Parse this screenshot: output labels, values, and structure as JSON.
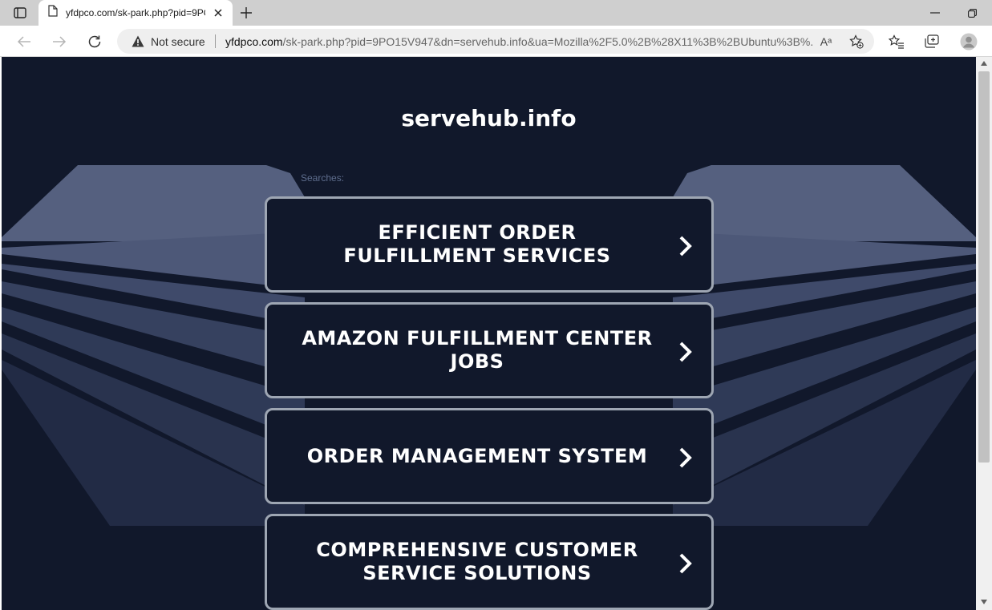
{
  "browser": {
    "tab_title": "yfdpco.com/sk-park.php?pid=9PO15V947",
    "security_label": "Not secure",
    "url_host": "yfdpco.com",
    "url_rest": "/sk-park.php?pid=9PO15V947&dn=servehub.info&ua=Mozilla%2F5.0%2B%28X11%3B%2BUbuntu%3B%...",
    "read_aloud_glyph": "Aᵃ"
  },
  "page": {
    "site_title": "servehub.info",
    "searches_label": "Searches:",
    "links": [
      {
        "label": "EFFICIENT ORDER FULFILLMENT SERVICES"
      },
      {
        "label": "AMAZON FULFILLMENT CENTER JOBS"
      },
      {
        "label": "ORDER MANAGEMENT SYSTEM"
      },
      {
        "label": "COMPREHENSIVE CUSTOMER SERVICE SOLUTIONS"
      }
    ]
  },
  "colors": {
    "page_background": "#11182b",
    "button_border": "#9ea6b3",
    "background_art": "#55607f"
  }
}
